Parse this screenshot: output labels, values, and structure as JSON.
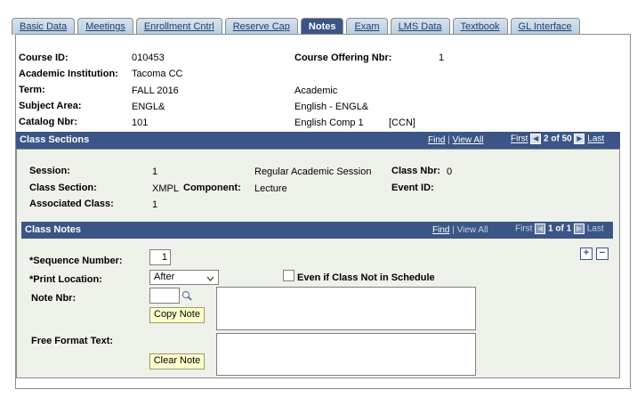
{
  "tabs": [
    {
      "label": "Basic Data",
      "active": false
    },
    {
      "label": "Meetings",
      "active": false
    },
    {
      "label": "Enrollment Cntrl",
      "active": false
    },
    {
      "label": "Reserve Cap",
      "active": false
    },
    {
      "label": "Notes",
      "active": true
    },
    {
      "label": "Exam",
      "active": false
    },
    {
      "label": "LMS Data",
      "active": false
    },
    {
      "label": "Textbook",
      "active": false
    },
    {
      "label": "GL Interface",
      "active": false
    }
  ],
  "header": {
    "course_id_label": "Course ID:",
    "course_id": "010453",
    "offering_label": "Course Offering Nbr:",
    "offering": "1",
    "institution_label": "Academic Institution:",
    "institution": "Tacoma CC",
    "term_label": "Term:",
    "term": "FALL 2016",
    "career": "Academic",
    "subject_label": "Subject Area:",
    "subject": "ENGL&",
    "subject_desc": "English - ENGL&",
    "catalog_label": "Catalog Nbr:",
    "catalog": "101",
    "catalog_desc": "English Comp 1",
    "ccn": "[CCN]"
  },
  "class_sections": {
    "title": "Class Sections",
    "find": "Find",
    "sep": "|",
    "view_all": "View All",
    "first": "First",
    "prev_arrow": "◀",
    "count": "2 of 50",
    "next_arrow": "▶",
    "last": "Last",
    "session_label": "Session:",
    "session": "1",
    "session_desc": "Regular Academic Session",
    "class_nbr_label": "Class Nbr:",
    "class_nbr": "0",
    "section_label": "Class Section:",
    "section": "XMPL",
    "component_label": "Component:",
    "component": "Lecture",
    "event_label": "Event ID:",
    "assoc_label": "Associated Class:",
    "assoc": "1"
  },
  "class_notes": {
    "title": "Class Notes",
    "find": "Find",
    "sep": "|",
    "view_all": "View All",
    "first": "First",
    "prev_arrow": "◀",
    "count": "1 of 1",
    "next_arrow": "▶",
    "last": "Last",
    "add": "+",
    "remove": "−",
    "seq_label": "*Sequence Number:",
    "seq": "1",
    "print_label": "*Print Location:",
    "print_value": "After",
    "even_label": "Even if Class Not in Schedule",
    "note_nbr_label": "Note Nbr:",
    "note_nbr": "",
    "copy_note": "Copy Note",
    "free_label": "Free Format Text:",
    "clear_note": "Clear Note",
    "note_text": "",
    "free_text": ""
  }
}
